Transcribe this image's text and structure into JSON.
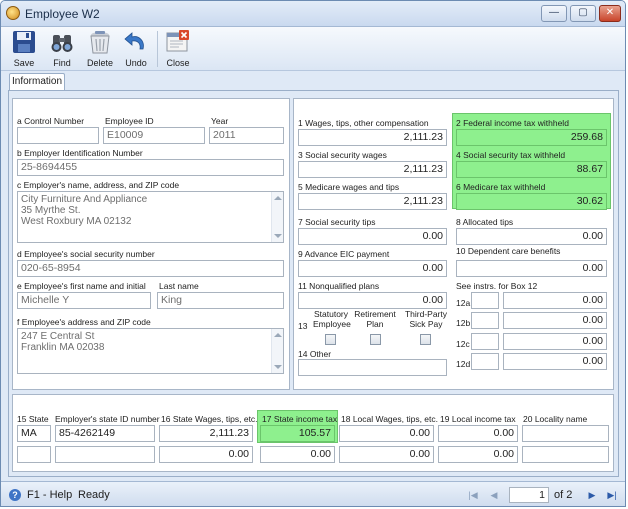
{
  "window": {
    "title": "Employee W2",
    "min": "—",
    "max": "▢",
    "close": "✕"
  },
  "toolbar": {
    "save": "Save",
    "find": "Find",
    "delete": "Delete",
    "undo": "Undo",
    "close": "Close"
  },
  "tabs": {
    "information": "Information"
  },
  "employer": {
    "control_label": "a  Control Number",
    "control_value": "",
    "empid_label": "Employee ID",
    "empid_value": "E10009",
    "year_label": "Year",
    "year_value": "2011",
    "ein_label": "b  Employer Identification Number",
    "ein_value": "25-8694455",
    "name_label": "c  Employer's name, address, and ZIP code",
    "name_lines": [
      "City Furniture And Appliance",
      "35 Myrthe St.",
      "West Roxbury MA 02132"
    ],
    "ssn_label": "d  Employee's social security number",
    "ssn_value": "020-65-8954",
    "first_label": "e  Employee's first name and initial",
    "first_value": "Michelle Y",
    "last_label": "Last name",
    "last_value": "King",
    "addr_label": "f  Employee's address and ZIP code",
    "addr_lines": [
      "247 E Central St",
      "Franklin MA 02038"
    ]
  },
  "boxes": {
    "b1_label": "1  Wages, tips, other compensation",
    "b1_value": "2,111.23",
    "b2_label": "2  Federal income tax withheld",
    "b2_value": "259.68",
    "b3_label": "3  Social security wages",
    "b3_value": "2,111.23",
    "b4_label": "4  Social security tax withheld",
    "b4_value": "88.67",
    "b5_label": "5  Medicare wages and tips",
    "b5_value": "2,111.23",
    "b6_label": "6  Medicare tax withheld",
    "b6_value": "30.62",
    "b7_label": "7  Social security tips",
    "b7_value": "0.00",
    "b8_label": "8  Allocated tips",
    "b8_value": "0.00",
    "b9_label": "9  Advance EIC payment",
    "b9_value": "0.00",
    "b10_label": "10  Dependent care benefits",
    "b10_value": "0.00",
    "b11_label": "11  Nonqualified plans",
    "b11_value": "0.00",
    "b12_label": "See instrs. for Box 12",
    "b12a_label": "12a",
    "b12a_code": "",
    "b12a_value": "0.00",
    "b12b_label": "12b",
    "b12b_code": "",
    "b12b_value": "0.00",
    "b12c_label": "12c",
    "b12c_code": "",
    "b12c_value": "0.00",
    "b12d_label": "12d",
    "b12d_code": "",
    "b12d_value": "0.00",
    "b13_label": "13",
    "statutory_l1": "Statutory",
    "statutory_l2": "Employee",
    "retirement_l1": "Retirement",
    "retirement_l2": "Plan",
    "thirdparty_l1": "Third-Party",
    "thirdparty_l2": "Sick Pay",
    "b14_label": "14  Other",
    "b14_value": ""
  },
  "state": {
    "state_label": "15  State",
    "stateid_label": "Employer's state ID number",
    "wages_label": "16  State Wages, tips, etc.",
    "tax_label": "17  State income tax",
    "localwages_label": "18  Local Wages, tips, etc.",
    "localtax_label": "19  Local income tax",
    "locality_label": "20  Locality name",
    "rows": [
      {
        "state": "MA",
        "stateid": "85-4262149",
        "wages": "2,111.23",
        "tax": "105.57",
        "localwages": "0.00",
        "localtax": "0.00",
        "locality": ""
      },
      {
        "state": "",
        "stateid": "",
        "wages": "0.00",
        "tax": "0.00",
        "localwages": "0.00",
        "localtax": "0.00",
        "locality": ""
      }
    ]
  },
  "status": {
    "help": "F1 - Help",
    "ready": "Ready",
    "page": "1",
    "of": "of  2"
  },
  "colors": {
    "highlight": "#8ef08e",
    "window_bg": "#dfe9f6",
    "accent": "#2c5aa8"
  }
}
